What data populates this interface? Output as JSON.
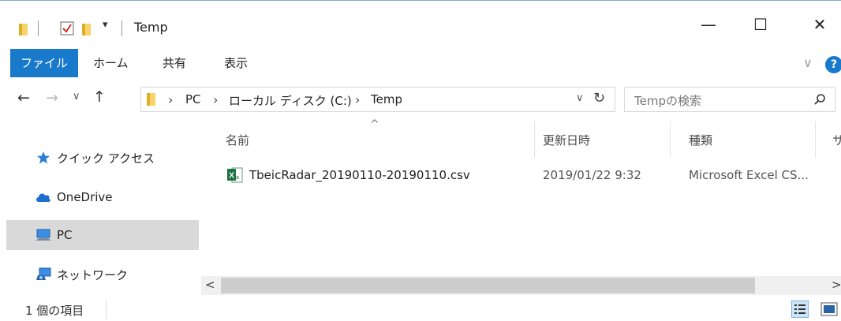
{
  "window": {
    "title": "Temp",
    "buttons": {
      "minimize": "—",
      "maximize": "☐",
      "close": "✕"
    }
  },
  "ribbon": {
    "tabs": [
      {
        "label": "ファイル",
        "active": true
      },
      {
        "label": "ホーム"
      },
      {
        "label": "共有"
      },
      {
        "label": "表示"
      }
    ],
    "expand_glyph": "∨",
    "help_glyph": "?"
  },
  "navigation": {
    "back": "←",
    "forward": "→",
    "recent": "∨",
    "up": "↑",
    "breadcrumb": [
      {
        "label": "PC"
      },
      {
        "label": "ローカル ディスク (C:)"
      },
      {
        "label": "Temp"
      }
    ],
    "breadcrumb_separator": "›",
    "address_dropdown": "∨",
    "refresh": "↻",
    "search_placeholder": "Tempの検索"
  },
  "sidebar": {
    "items": [
      {
        "label": "クイック アクセス",
        "icon": "star-icon",
        "selected": false
      },
      {
        "label": "OneDrive",
        "icon": "cloud-icon",
        "selected": false
      },
      {
        "label": "PC",
        "icon": "computer-icon",
        "selected": true
      },
      {
        "label": "ネットワーク",
        "icon": "network-icon",
        "selected": false
      }
    ]
  },
  "file_list": {
    "sort_indicator": "^",
    "columns": [
      "名前",
      "更新日時",
      "種類",
      "サ"
    ],
    "rows": [
      {
        "name": "TbeicRadar_20190110-20190110.csv",
        "modified": "2019/01/22 9:32",
        "type": "Microsoft Excel CS...",
        "icon": "excel-csv-icon"
      }
    ]
  },
  "scrollbar": {
    "left_arrow": "<",
    "right_arrow": ">"
  },
  "status": {
    "item_count": "1 個の項目"
  },
  "colors": {
    "accent": "#1979ca",
    "selected_bg": "#d9d9d9",
    "folder": "#f8d36a"
  }
}
